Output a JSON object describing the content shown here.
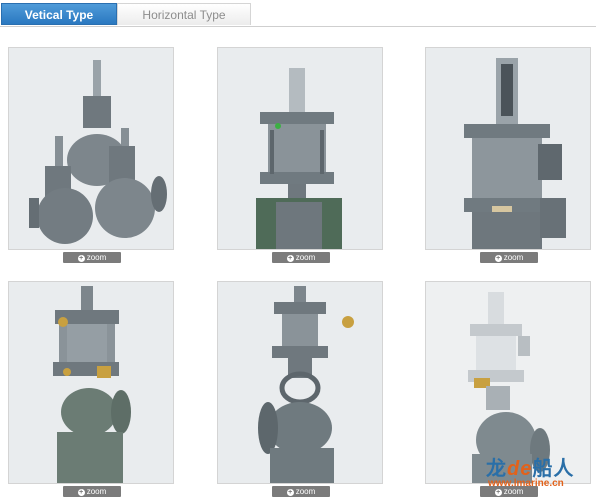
{
  "tabs": [
    {
      "label": "Vetical Type",
      "active": true
    },
    {
      "label": "Horizontal Type",
      "active": false
    }
  ],
  "gallery": [
    {
      "zoom_label": "zoom"
    },
    {
      "zoom_label": "zoom"
    },
    {
      "zoom_label": "zoom"
    },
    {
      "zoom_label": "zoom"
    },
    {
      "zoom_label": "zoom"
    },
    {
      "zoom_label": "zoom"
    }
  ],
  "watermark": {
    "brand_left": "龙",
    "brand_mid": "de",
    "brand_right": "船人",
    "url": "www.lmarine.cn"
  },
  "colors": {
    "tab_active": "#2a78c0",
    "valve_gray": "#7d868c",
    "zoom_bg": "#7b7b7b",
    "watermark_blue": "#2a6fa8",
    "watermark_orange": "#e2621b"
  }
}
